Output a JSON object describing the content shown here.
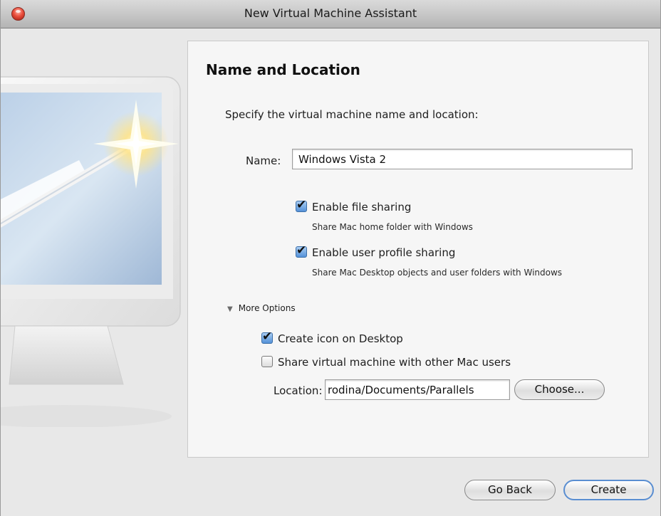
{
  "window": {
    "title": "New Virtual Machine Assistant"
  },
  "page": {
    "heading": "Name and Location",
    "subtitle": "Specify the virtual machine name and location:"
  },
  "name_field": {
    "label": "Name:",
    "value": "Windows Vista 2"
  },
  "options": [
    {
      "label": "Enable file sharing",
      "checked": true,
      "description": "Share Mac home folder with Windows"
    },
    {
      "label": "Enable user profile sharing",
      "checked": true,
      "description": "Share Mac Desktop objects and user folders with Windows"
    }
  ],
  "more_options": {
    "label": "More Options",
    "expanded": true,
    "checkboxes": [
      {
        "label": "Create icon on Desktop",
        "checked": true
      },
      {
        "label": "Share virtual machine with other Mac users",
        "checked": false
      }
    ],
    "location": {
      "label": "Location:",
      "value": "rodina/Documents/Parallels",
      "choose_label": "Choose..."
    }
  },
  "footer": {
    "back_label": "Go Back",
    "create_label": "Create"
  },
  "colors": {
    "accent": "#5a8ed1",
    "checkbox_checked": "#5592d8",
    "close_button": "#ea4e3c"
  }
}
